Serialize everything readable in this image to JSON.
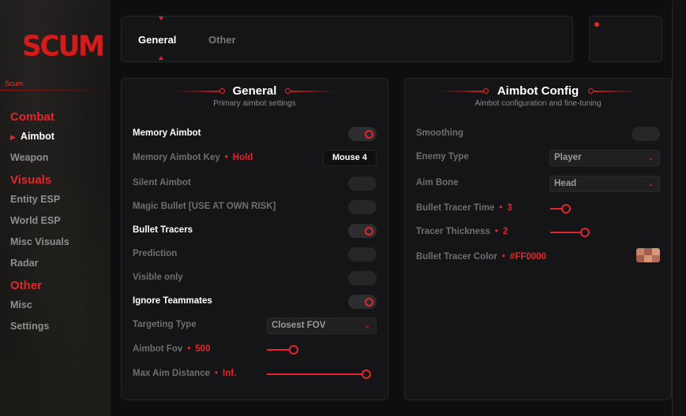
{
  "sidebar": {
    "logo_text": "SCUM",
    "brand_sub": "Scum",
    "sections": [
      {
        "title": "Combat",
        "items": [
          {
            "label": "Aimbot",
            "active": true
          },
          {
            "label": "Weapon",
            "active": false
          }
        ]
      },
      {
        "title": "Visuals",
        "items": [
          {
            "label": "Entity ESP",
            "active": false
          },
          {
            "label": "World ESP",
            "active": false
          },
          {
            "label": "Misc Visuals",
            "active": false
          },
          {
            "label": "Radar",
            "active": false
          }
        ]
      },
      {
        "title": "Other",
        "items": [
          {
            "label": "Misc",
            "active": false
          },
          {
            "label": "Settings",
            "active": false
          }
        ]
      }
    ]
  },
  "tabs": [
    {
      "label": "General",
      "active": true
    },
    {
      "label": "Other",
      "active": false
    }
  ],
  "general": {
    "title": "General",
    "subtitle": "Primary aimbot settings",
    "memory_aimbot": {
      "label": "Memory Aimbot",
      "enabled": true
    },
    "memory_aimbot_key": {
      "label": "Memory Aimbot Key",
      "mode": "Hold",
      "key": "Mouse 4"
    },
    "silent_aimbot": {
      "label": "Silent Aimbot",
      "enabled": false
    },
    "magic_bullet": {
      "label": "Magic Bullet [USE AT OWN RISK]",
      "enabled": false
    },
    "bullet_tracers": {
      "label": "Bullet Tracers",
      "enabled": true
    },
    "prediction": {
      "label": "Prediction",
      "enabled": false
    },
    "visible_only": {
      "label": "Visible only",
      "enabled": false
    },
    "ignore_teammates": {
      "label": "Ignore Teammates",
      "enabled": true
    },
    "targeting_type": {
      "label": "Targeting Type",
      "value": "Closest FOV"
    },
    "aimbot_fov": {
      "label": "Aimbot Fov",
      "value": "500",
      "fraction": 0.26
    },
    "max_aim_distance": {
      "label": "Max Aim Distance",
      "value": "Inf.",
      "fraction": 1.0
    }
  },
  "aimbot_config": {
    "title": "Aimbot Config",
    "subtitle": "Aimbot configuration and fine-tuning",
    "smoothing": {
      "label": "Smoothing",
      "enabled": false
    },
    "enemy_type": {
      "label": "Enemy Type",
      "value": "Player"
    },
    "aim_bone": {
      "label": "Aim Bone",
      "value": "Head"
    },
    "bullet_tracer_time": {
      "label": "Bullet Tracer Time",
      "value": "3",
      "fraction": 0.33
    },
    "tracer_thickness": {
      "label": "Tracer Thickness",
      "value": "2",
      "fraction": 0.66
    },
    "bullet_tracer_color": {
      "label": "Bullet Tracer Color",
      "value": "#FF0000"
    }
  },
  "colors": {
    "accent": "#e3262b",
    "panel": "#151517",
    "background": "#0e0e10"
  }
}
